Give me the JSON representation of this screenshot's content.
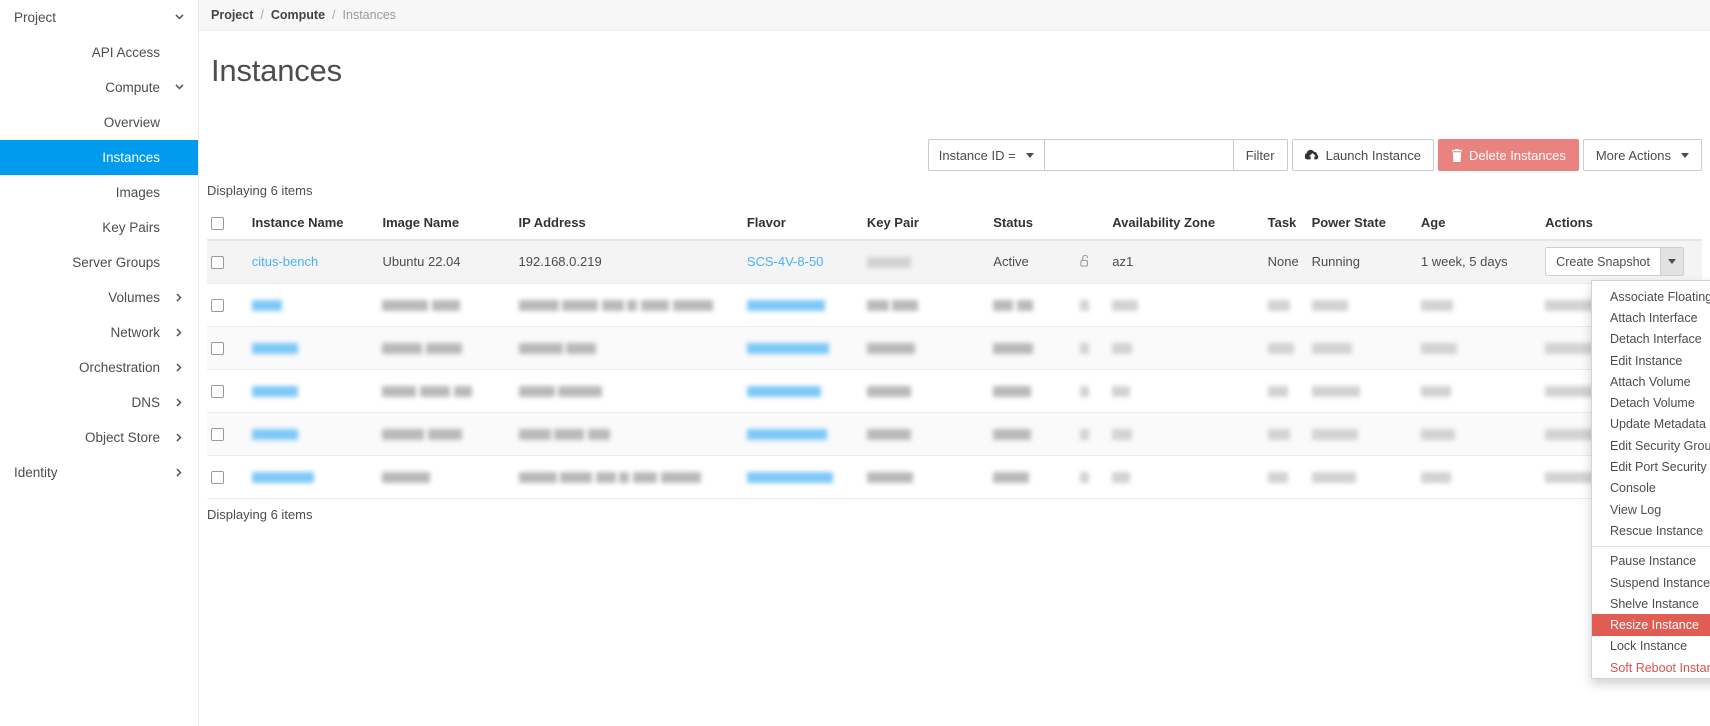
{
  "sidebar": {
    "items": [
      {
        "label": "Project",
        "level": 0,
        "icon": "chevron-down-icon",
        "active": false
      },
      {
        "label": "API Access",
        "level": 1,
        "icon": "",
        "active": false
      },
      {
        "label": "Compute",
        "level": 1,
        "icon": "chevron-down-icon",
        "active": false
      },
      {
        "label": "Overview",
        "level": 2,
        "icon": "",
        "active": false
      },
      {
        "label": "Instances",
        "level": 2,
        "icon": "",
        "active": true
      },
      {
        "label": "Images",
        "level": 2,
        "icon": "",
        "active": false
      },
      {
        "label": "Key Pairs",
        "level": 2,
        "icon": "",
        "active": false
      },
      {
        "label": "Server Groups",
        "level": 2,
        "icon": "",
        "active": false
      },
      {
        "label": "Volumes",
        "level": 1,
        "icon": "chevron-right-icon",
        "active": false
      },
      {
        "label": "Network",
        "level": 1,
        "icon": "chevron-right-icon",
        "active": false
      },
      {
        "label": "Orchestration",
        "level": 1,
        "icon": "chevron-right-icon",
        "active": false
      },
      {
        "label": "DNS",
        "level": 1,
        "icon": "chevron-right-icon",
        "active": false
      },
      {
        "label": "Object Store",
        "level": 1,
        "icon": "chevron-right-icon",
        "active": false
      },
      {
        "label": "Identity",
        "level": 0,
        "icon": "chevron-right-icon",
        "active": false
      }
    ]
  },
  "breadcrumb": {
    "project": "Project",
    "compute": "Compute",
    "current": "Instances",
    "separator": "/"
  },
  "page": {
    "title": "Instances",
    "count_top": "Displaying 6 items",
    "count_bottom": "Displaying 6 items"
  },
  "toolbar": {
    "filter_select": "Instance ID =",
    "filter_placeholder": "",
    "filter_value": "",
    "filter_button": "Filter",
    "launch_button": "Launch Instance",
    "delete_button": "Delete Instances",
    "more_actions_button": "More Actions",
    "danger_color": "#e8837f",
    "accent_color": "#009bef"
  },
  "table": {
    "columns": [
      "Instance Name",
      "Image Name",
      "IP Address",
      "Flavor",
      "Key Pair",
      "Status",
      "Availability Zone",
      "Task",
      "Power State",
      "Age",
      "Actions"
    ],
    "rows": [
      {
        "redacted": false,
        "instance_name": "citus-bench",
        "image_name": "Ubuntu 22.04",
        "ip_address": "192.168.0.219",
        "flavor": "SCS-4V-8-50",
        "key_pair": "",
        "status": "Active",
        "availability_zone": "az1",
        "task": "None",
        "power_state": "Running",
        "age": "1 week, 5 days",
        "action_label": "Create Snapshot"
      },
      {
        "redacted": true,
        "instance_name": "",
        "image_name": "",
        "ip_address": "",
        "flavor": "",
        "key_pair": "",
        "status": "",
        "availability_zone": "",
        "task": "",
        "power_state": "",
        "age": "",
        "action_label": ""
      },
      {
        "redacted": true,
        "instance_name": "",
        "image_name": "",
        "ip_address": "",
        "flavor": "",
        "key_pair": "",
        "status": "",
        "availability_zone": "",
        "task": "",
        "power_state": "",
        "age": "",
        "action_label": ""
      },
      {
        "redacted": true,
        "instance_name": "",
        "image_name": "",
        "ip_address": "",
        "flavor": "",
        "key_pair": "",
        "status": "",
        "availability_zone": "",
        "task": "",
        "power_state": "",
        "age": "",
        "action_label": ""
      },
      {
        "redacted": true,
        "instance_name": "",
        "image_name": "",
        "ip_address": "",
        "flavor": "",
        "key_pair": "",
        "status": "",
        "availability_zone": "",
        "task": "",
        "power_state": "",
        "age": "",
        "action_label": ""
      },
      {
        "redacted": true,
        "instance_name": "",
        "image_name": "",
        "ip_address": "",
        "flavor": "",
        "key_pair": "",
        "status": "",
        "availability_zone": "",
        "task": "",
        "power_state": "",
        "age": "",
        "action_label": ""
      }
    ]
  },
  "actions_menu": {
    "highlight_color": "#e15d53",
    "items": [
      {
        "label": "Associate Floating IP",
        "state": "normal"
      },
      {
        "label": "Attach Interface",
        "state": "normal"
      },
      {
        "label": "Detach Interface",
        "state": "normal"
      },
      {
        "label": "Edit Instance",
        "state": "normal"
      },
      {
        "label": "Attach Volume",
        "state": "normal"
      },
      {
        "label": "Detach Volume",
        "state": "normal"
      },
      {
        "label": "Update Metadata",
        "state": "normal"
      },
      {
        "label": "Edit Security Groups",
        "state": "normal"
      },
      {
        "label": "Edit Port Security Groups",
        "state": "normal"
      },
      {
        "label": "Console",
        "state": "normal"
      },
      {
        "label": "View Log",
        "state": "normal"
      },
      {
        "label": "Rescue Instance",
        "state": "normal"
      },
      {
        "label": "Pause Instance",
        "state": "normal"
      },
      {
        "label": "Suspend Instance",
        "state": "normal"
      },
      {
        "label": "Shelve Instance",
        "state": "normal"
      },
      {
        "label": "Resize Instance",
        "state": "highlighted"
      },
      {
        "label": "Lock Instance",
        "state": "normal"
      },
      {
        "label": "Soft Reboot Instance",
        "state": "danger"
      }
    ]
  }
}
